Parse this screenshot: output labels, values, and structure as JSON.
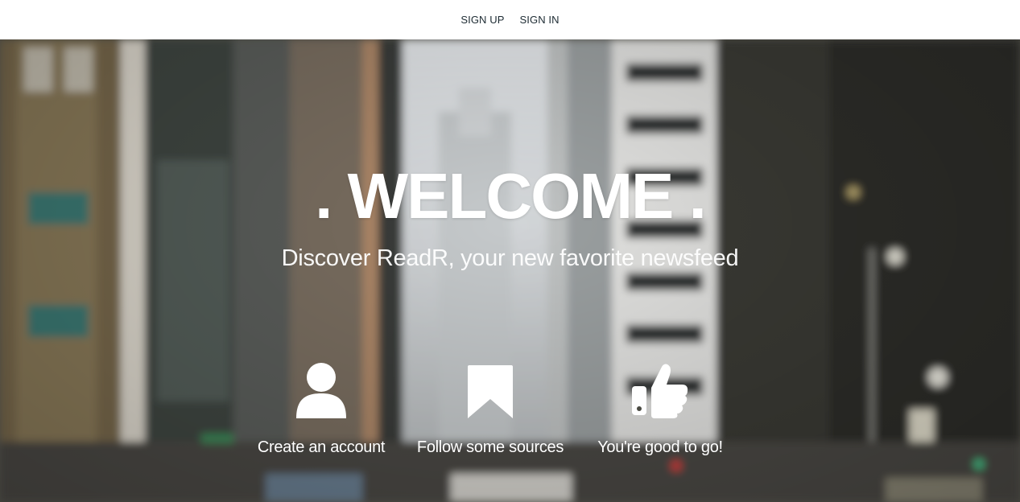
{
  "nav": {
    "signup_label": "SIGN UP",
    "signin_label": "SIGN IN"
  },
  "hero": {
    "title": ". WELCOME .",
    "subtitle": "Discover ReadR, your new favorite newsfeed",
    "steps": [
      {
        "label": "Create an account",
        "icon": "user-icon"
      },
      {
        "label": "Follow some sources",
        "icon": "bookmark-icon"
      },
      {
        "label": "You're good to go!",
        "icon": "thumbs-up-icon"
      }
    ]
  },
  "colors": {
    "nav_background": "#ffffff",
    "nav_text": "#1d2b33",
    "hero_text": "#ffffff"
  }
}
